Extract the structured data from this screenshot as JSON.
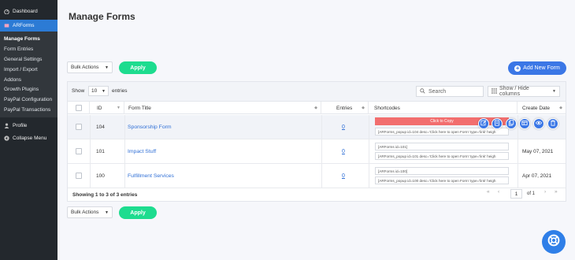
{
  "sidebar": {
    "dashboard": "Dashboard",
    "arforms": "ARForms",
    "submenu": [
      "Manage Forms",
      "Form Entries",
      "General Settings",
      "Import / Export",
      "Addons",
      "Growth Plugins",
      "PayPal Configuration",
      "PayPal Transactions"
    ],
    "profile": "Profile",
    "collapse": "Collapse Menu"
  },
  "page": {
    "title": "Manage Forms"
  },
  "bulk_top": {
    "label": "Bulk Actions",
    "apply": "Apply"
  },
  "bulk_bottom": {
    "label": "Bulk Actions",
    "apply": "Apply"
  },
  "add_new": "Add New Form",
  "toolbar": {
    "show": "Show",
    "show_value": "10",
    "entries": "entries",
    "search_placeholder": "Search",
    "show_hide": "Show / Hide columns"
  },
  "columns": {
    "id": "ID",
    "title": "Form Title",
    "entries": "Entries",
    "shortcodes": "Shortcodes",
    "date": "Create Date"
  },
  "rows": [
    {
      "id": "104",
      "title": "Sponsorship Form",
      "entries": "0",
      "copy": "Click to Copy",
      "shortcode_popup": "[ARForms_popup id=104 desc='Click here to open Form' type='link' heigh",
      "date": ""
    },
    {
      "id": "101",
      "title": "Impact Stuff",
      "entries": "0",
      "shortcode": "[ARForms id=101]",
      "shortcode_popup": "[ARForms_popup id=101 desc='Click here to open Form' type='link' heigh",
      "date": "May 07, 2021"
    },
    {
      "id": "100",
      "title": "Fulfillment Services",
      "entries": "0",
      "shortcode": "[ARForms id=100]",
      "shortcode_popup": "[ARForms_popup id=100 desc='Click here to open Form' type='link' heigh",
      "date": "Apr 07, 2021"
    }
  ],
  "footer": {
    "info": "Showing 1 to 3 of 3 entries",
    "page": "1",
    "of": "of 1"
  },
  "colors": {
    "accent": "#3b77e6",
    "apply": "#1ddc8f",
    "sidebar": "#23282d",
    "active": "#2c7bd5",
    "copy": "#f26e6e"
  }
}
